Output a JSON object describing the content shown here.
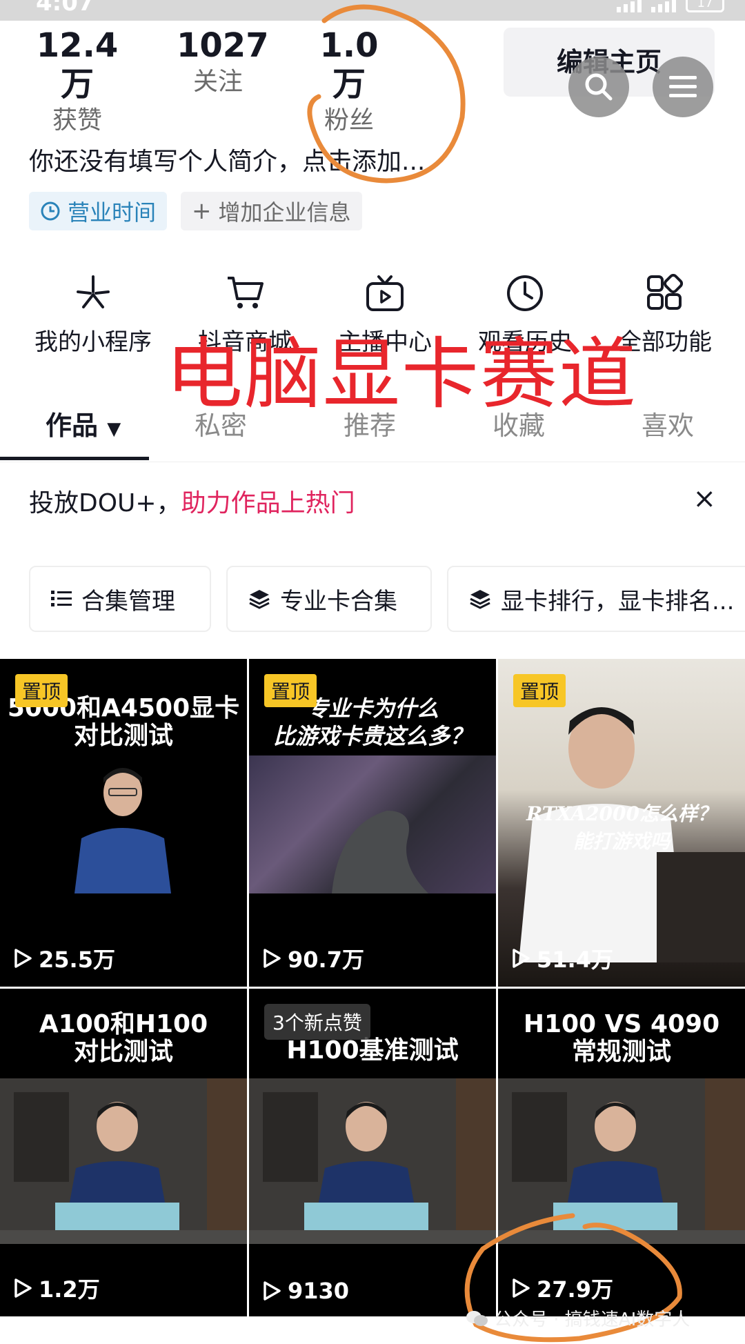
{
  "status": {
    "time": "4:07",
    "battery": "17"
  },
  "stats": [
    {
      "num": "12.4万",
      "label": "获赞"
    },
    {
      "num": "1027",
      "label": "关注"
    },
    {
      "num": "1.0万",
      "label": "粉丝"
    }
  ],
  "edit_label": "编辑主页",
  "bio": "你还没有填写个人简介，点击添加...",
  "tags": {
    "hours": "营业时间",
    "biz": "增加企业信息"
  },
  "functions": [
    {
      "label": "我的小程序",
      "icon": "asterisk-icon"
    },
    {
      "label": "抖音商城",
      "icon": "cart-icon"
    },
    {
      "label": "主播中心",
      "icon": "tv-play-icon"
    },
    {
      "label": "观看历史",
      "icon": "clock-icon"
    },
    {
      "label": "全部功能",
      "icon": "grid-icon"
    }
  ],
  "overlay_title": "电脑显卡赛道",
  "tabs": [
    "作品",
    "私密",
    "推荐",
    "收藏",
    "喜欢"
  ],
  "dou": {
    "plain": "投放DOU+，",
    "highlight": "助力作品上热门",
    "close": "×"
  },
  "collections": [
    "合集管理",
    "专业卡合集",
    "显卡排行，显卡排名..."
  ],
  "videos": [
    {
      "caption": "5000和A4500显卡\n对比测试",
      "pinned": "置顶",
      "views": "25.5万"
    },
    {
      "caption": "专业卡为什么\n比游戏卡贵这么多？",
      "pinned": "置顶",
      "views": "90.7万"
    },
    {
      "caption": "RTXA2000怎么样？\n能打游戏吗",
      "pinned": "置顶",
      "views": "51.4万"
    },
    {
      "caption": "A100和H100\n对比测试",
      "views": "1.2万"
    },
    {
      "caption": "H100基准测试",
      "likes_badge": "3个新点赞",
      "views": "9130"
    },
    {
      "caption": "H100 VS 4090\n常规测试",
      "views": "27.9万"
    }
  ],
  "watermark": "公众号 · 搞钱速AI数字人",
  "colors": {
    "accent_pink": "#e0245e",
    "overlay_red": "#e8262c",
    "annotation_orange": "#e98a3a",
    "pin_yellow": "#f7c626"
  }
}
